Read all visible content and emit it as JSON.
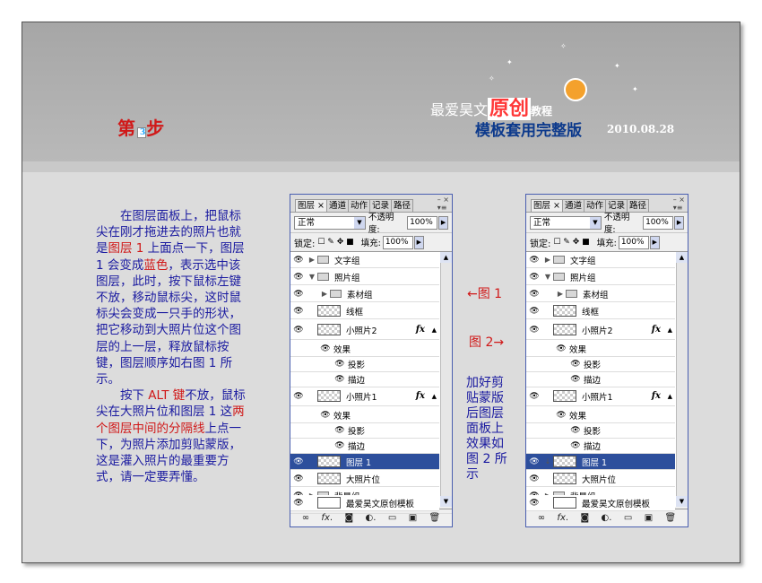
{
  "banner": {
    "step_prefix": "第",
    "step_number": "3",
    "step_suffix": "步",
    "brand_main": "最爱昊文",
    "brand_big": "原创",
    "brand_tut": "教程",
    "subtitle": "模板套用完整版",
    "date": "2010.08.28"
  },
  "instructions": {
    "p1_a": "在图层面板上，把鼠标尖在刚才拖进去的照片也就是",
    "p1_red1": "图层 1",
    "p1_b": " 上面点一下，图层 1 会变成",
    "p1_red2": "蓝色",
    "p1_c": "，表示选中该图层，此时，按下鼠标左键不放，移动鼠标尖，这时鼠标尖会变成一只手的形状，把它移动到大照片位这个图层的上一层，释放鼠标按键，图层顺序如右图 1 所示。",
    "p2_a": "按下 ",
    "p2_red1": "ALT 键",
    "p2_b": "不放，鼠标尖在大照片位和图层 1 这",
    "p2_red2": "两个图层中间的分隔线",
    "p2_c": "上点一下，为照片添加剪贴蒙版，这是灌入照片的最重要方式，请一定要弄懂。"
  },
  "annotations": {
    "fig1": "←图 1",
    "fig2": "图 2→",
    "desc": "加好剪贴蒙版后图层面板上效果如图 2 所示"
  },
  "panel": {
    "tabs": [
      "图层 ×",
      "通道",
      "动作",
      "记录",
      "路径"
    ],
    "blend_mode": "正常",
    "opacity_label": "不透明度:",
    "opacity_value": "100%",
    "lock_label": "锁定:",
    "fill_label": "填充:",
    "fill_value": "100%",
    "layers": {
      "text_group": "文字组",
      "photo_group": "照片组",
      "material_group": "素材组",
      "frame": "线框",
      "small_photo2": "小照片2",
      "effects": "效果",
      "drop_shadow": "投影",
      "stroke": "描边",
      "small_photo1": "小照片1",
      "layer1": "图层 1",
      "big_photo_slot": "大照片位",
      "bg_group": "背景组",
      "template": "最爱昊文原创模板"
    },
    "fx_label": "fx"
  }
}
